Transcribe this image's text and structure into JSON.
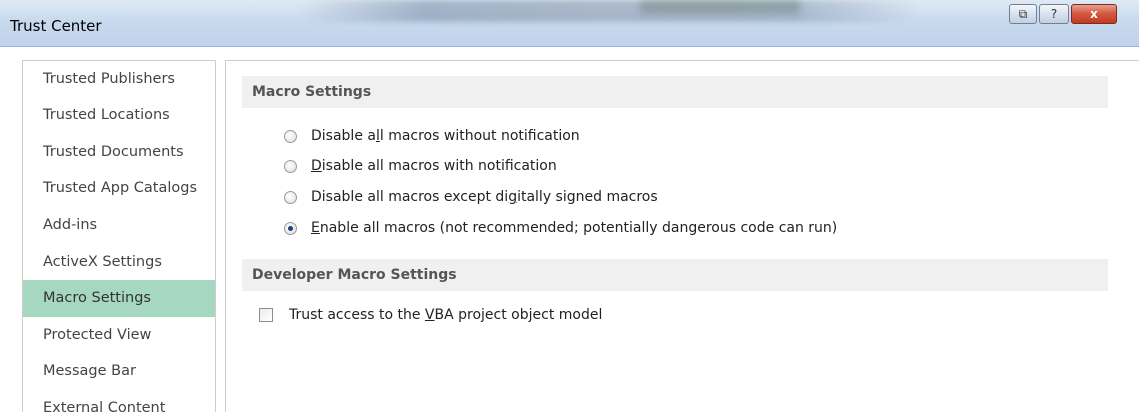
{
  "window": {
    "title": "Trust Center",
    "restore_glyph": "⧉",
    "help_glyph": "?",
    "close_glyph": "x"
  },
  "nav": {
    "items": [
      {
        "label": "Trusted Publishers"
      },
      {
        "label": "Trusted Locations"
      },
      {
        "label": "Trusted Documents"
      },
      {
        "label": "Trusted App Catalogs"
      },
      {
        "label": "Add-ins"
      },
      {
        "label": "ActiveX Settings"
      },
      {
        "label": "Macro Settings",
        "selected": true
      },
      {
        "label": "Protected View"
      },
      {
        "label": "Message Bar"
      },
      {
        "label": "External Content"
      }
    ]
  },
  "macro_settings": {
    "header": "Macro Settings",
    "options": [
      {
        "pre": "Disable a",
        "accel": "l",
        "post": "l macros without notification",
        "checked": false
      },
      {
        "pre": "",
        "accel": "D",
        "post": "isable all macros with notification",
        "checked": false
      },
      {
        "pre": "Disable all macros except di",
        "accel": "g",
        "post": "itally signed macros",
        "checked": false
      },
      {
        "pre": "",
        "accel": "E",
        "post": "nable all macros (not recommended; potentially dangerous code can run)",
        "checked": true
      }
    ]
  },
  "developer_settings": {
    "header": "Developer Macro Settings",
    "trust_vba": {
      "pre": "Trust access to the ",
      "accel": "V",
      "post": "BA project object model",
      "checked": false
    }
  },
  "colors": {
    "selected_nav": "#a6d8c1",
    "section_header_bg": "#f0f0f0",
    "close_button": "#c8452b"
  }
}
